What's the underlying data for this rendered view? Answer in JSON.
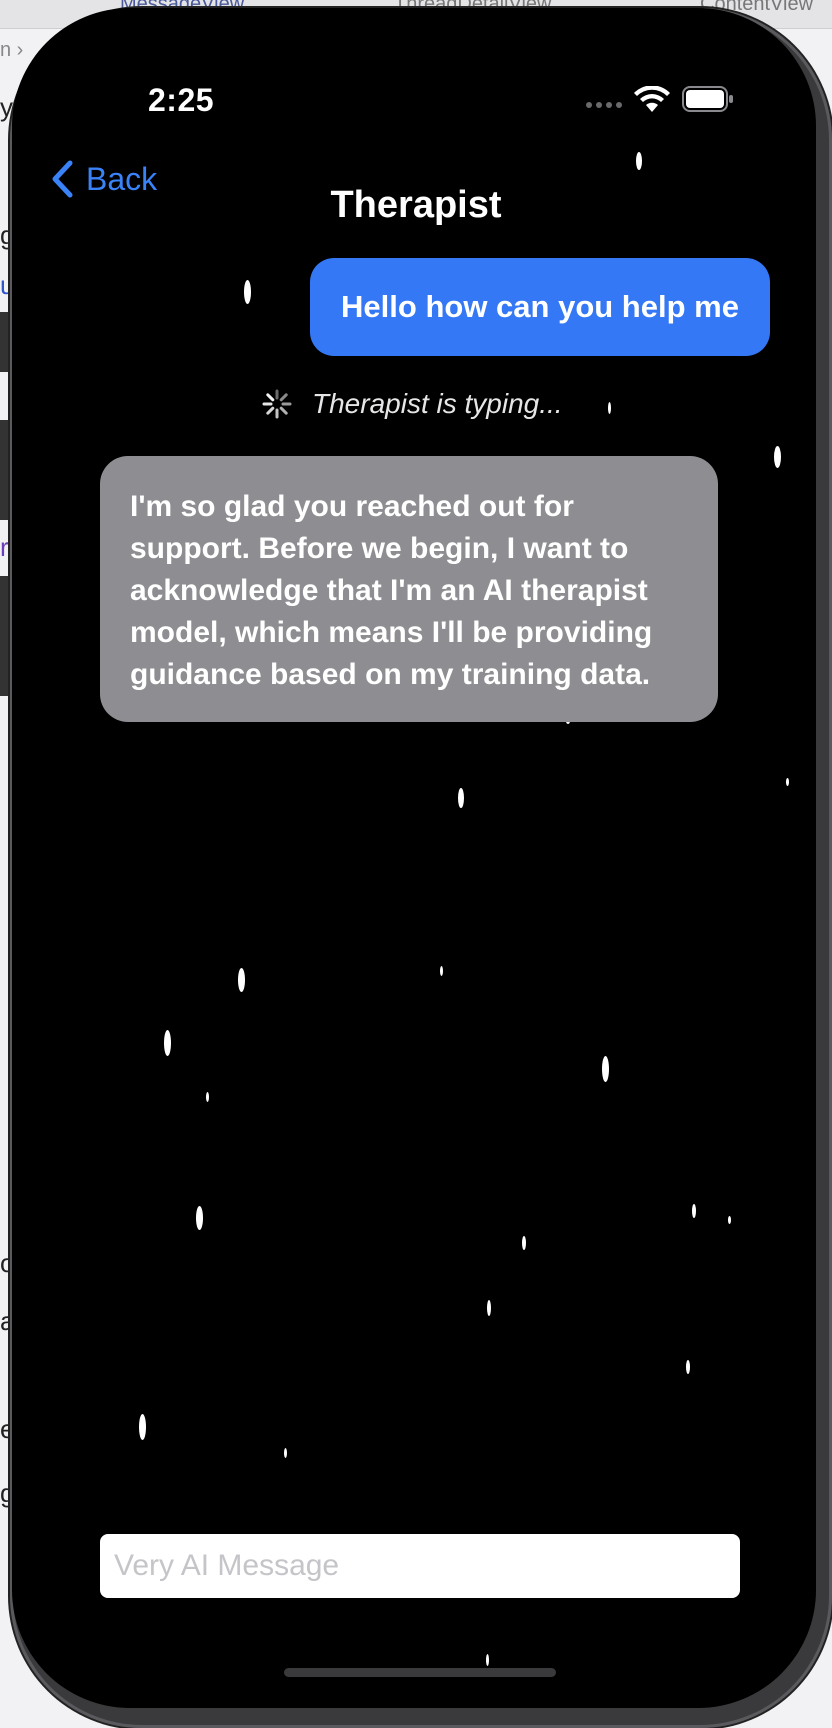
{
  "background_editor": {
    "tabs": [
      "MessageView",
      "ThreadDetailView",
      "ContentView"
    ]
  },
  "status_bar": {
    "time": "2:25",
    "wifi_icon": "wifi-icon",
    "battery_icon": "battery-icon"
  },
  "nav": {
    "back_label": "Back",
    "title": "Therapist"
  },
  "messages": {
    "user": "Hello how can you help me",
    "typing_indicator": "Therapist is typing...",
    "ai": "I'm so glad you reached out for support. Before we begin, I want to acknowledge that I'm an AI therapist model, which means I'll be providing guidance based on my training data."
  },
  "composer": {
    "placeholder": "Very AI Message",
    "value": ""
  },
  "colors": {
    "accent": "#3a82f7",
    "user_bubble": "#3478f6",
    "ai_bubble": "#8e8e92",
    "background": "#000000"
  }
}
